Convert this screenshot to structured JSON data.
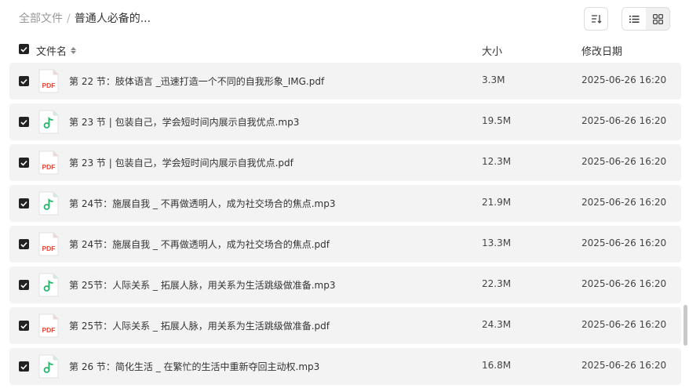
{
  "breadcrumb": {
    "root": "全部文件",
    "separator": "/",
    "current": "普通人必备的..."
  },
  "columns": {
    "name": "文件名",
    "size": "大小",
    "date": "修改日期"
  },
  "files": [
    {
      "name": "第 22 节：肢体语言 _迅速打造一个不同的自我形象_IMG.pdf",
      "type": "pdf",
      "size": "3.3M",
      "date": "2025-06-26 16:20"
    },
    {
      "name": "第 23 节 | 包装自己，学会短时间内展示自我优点.mp3",
      "type": "mp3",
      "size": "19.5M",
      "date": "2025-06-26 16:20"
    },
    {
      "name": "第 23 节 | 包装自己，学会短时间内展示自我优点.pdf",
      "type": "pdf",
      "size": "12.3M",
      "date": "2025-06-26 16:20"
    },
    {
      "name": "第 24节：施展自我 _ 不再做透明人，成为社交场合的焦点.mp3",
      "type": "mp3",
      "size": "21.9M",
      "date": "2025-06-26 16:20"
    },
    {
      "name": "第 24节：施展自我 _ 不再做透明人，成为社交场合的焦点.pdf",
      "type": "pdf",
      "size": "13.3M",
      "date": "2025-06-26 16:20"
    },
    {
      "name": "第 25节：人际关系 _ 拓展人脉，用关系为生活跳级做准备.mp3",
      "type": "mp3",
      "size": "22.3M",
      "date": "2025-06-26 16:20"
    },
    {
      "name": "第 25节：人际关系 _ 拓展人脉，用关系为生活跳级做准备.pdf",
      "type": "pdf",
      "size": "24.3M",
      "date": "2025-06-26 16:20"
    },
    {
      "name": "第 26 节：简化生活 _ 在繁忙的生活中重新夺回主动权.mp3",
      "type": "mp3",
      "size": "16.8M",
      "date": "2025-06-26 16:20"
    }
  ],
  "icons": {
    "pdf": "pdf-file-icon",
    "mp3": "audio-file-icon",
    "sort": "sort-icon",
    "list_view": "list-view-icon",
    "grid_view": "grid-view-icon",
    "checkbox": "checkbox-checked-icon"
  },
  "colors": {
    "pdf_red": "#e5483d",
    "audio_green": "#27b46b",
    "row_bg": "#f3f3f3",
    "checkbox": "#222222"
  }
}
